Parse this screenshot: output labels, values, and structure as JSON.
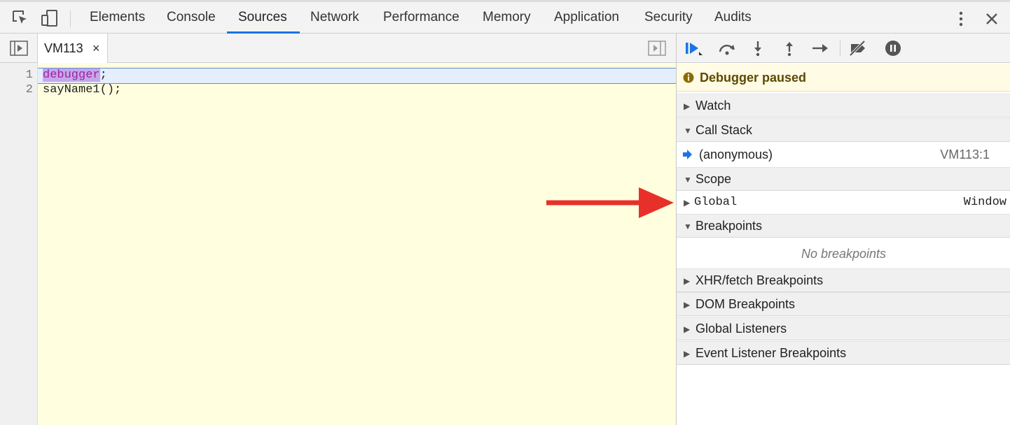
{
  "tabs": [
    "Elements",
    "Console",
    "Sources",
    "Network",
    "Performance",
    "Memory",
    "Application",
    "Security",
    "Audits"
  ],
  "active_tab": "Sources",
  "file_tab": {
    "name": "VM113",
    "close": "×"
  },
  "code": {
    "line_numbers": [
      "1",
      "2"
    ],
    "line1": {
      "keyword": "debugger",
      "rest": ";"
    },
    "line2": "sayName1();"
  },
  "sidebar": {
    "paused_text": "Debugger paused",
    "watch": "Watch",
    "call_stack": "Call Stack",
    "frame": {
      "name": "(anonymous)",
      "location": "VM113:1"
    },
    "scope": "Scope",
    "scope_item": {
      "name": "Global",
      "value": "Window"
    },
    "breakpoints": "Breakpoints",
    "no_breakpoints": "No breakpoints",
    "xhr_breakpoints": "XHR/fetch Breakpoints",
    "dom_breakpoints": "DOM Breakpoints",
    "global_listeners": "Global Listeners",
    "event_listener_breakpoints": "Event Listener Breakpoints"
  },
  "colors": {
    "accent": "#1a73e8",
    "annotation_arrow": "#e8302a",
    "editor_bg": "#fffedf",
    "paused_bg": "#fffbe5"
  }
}
